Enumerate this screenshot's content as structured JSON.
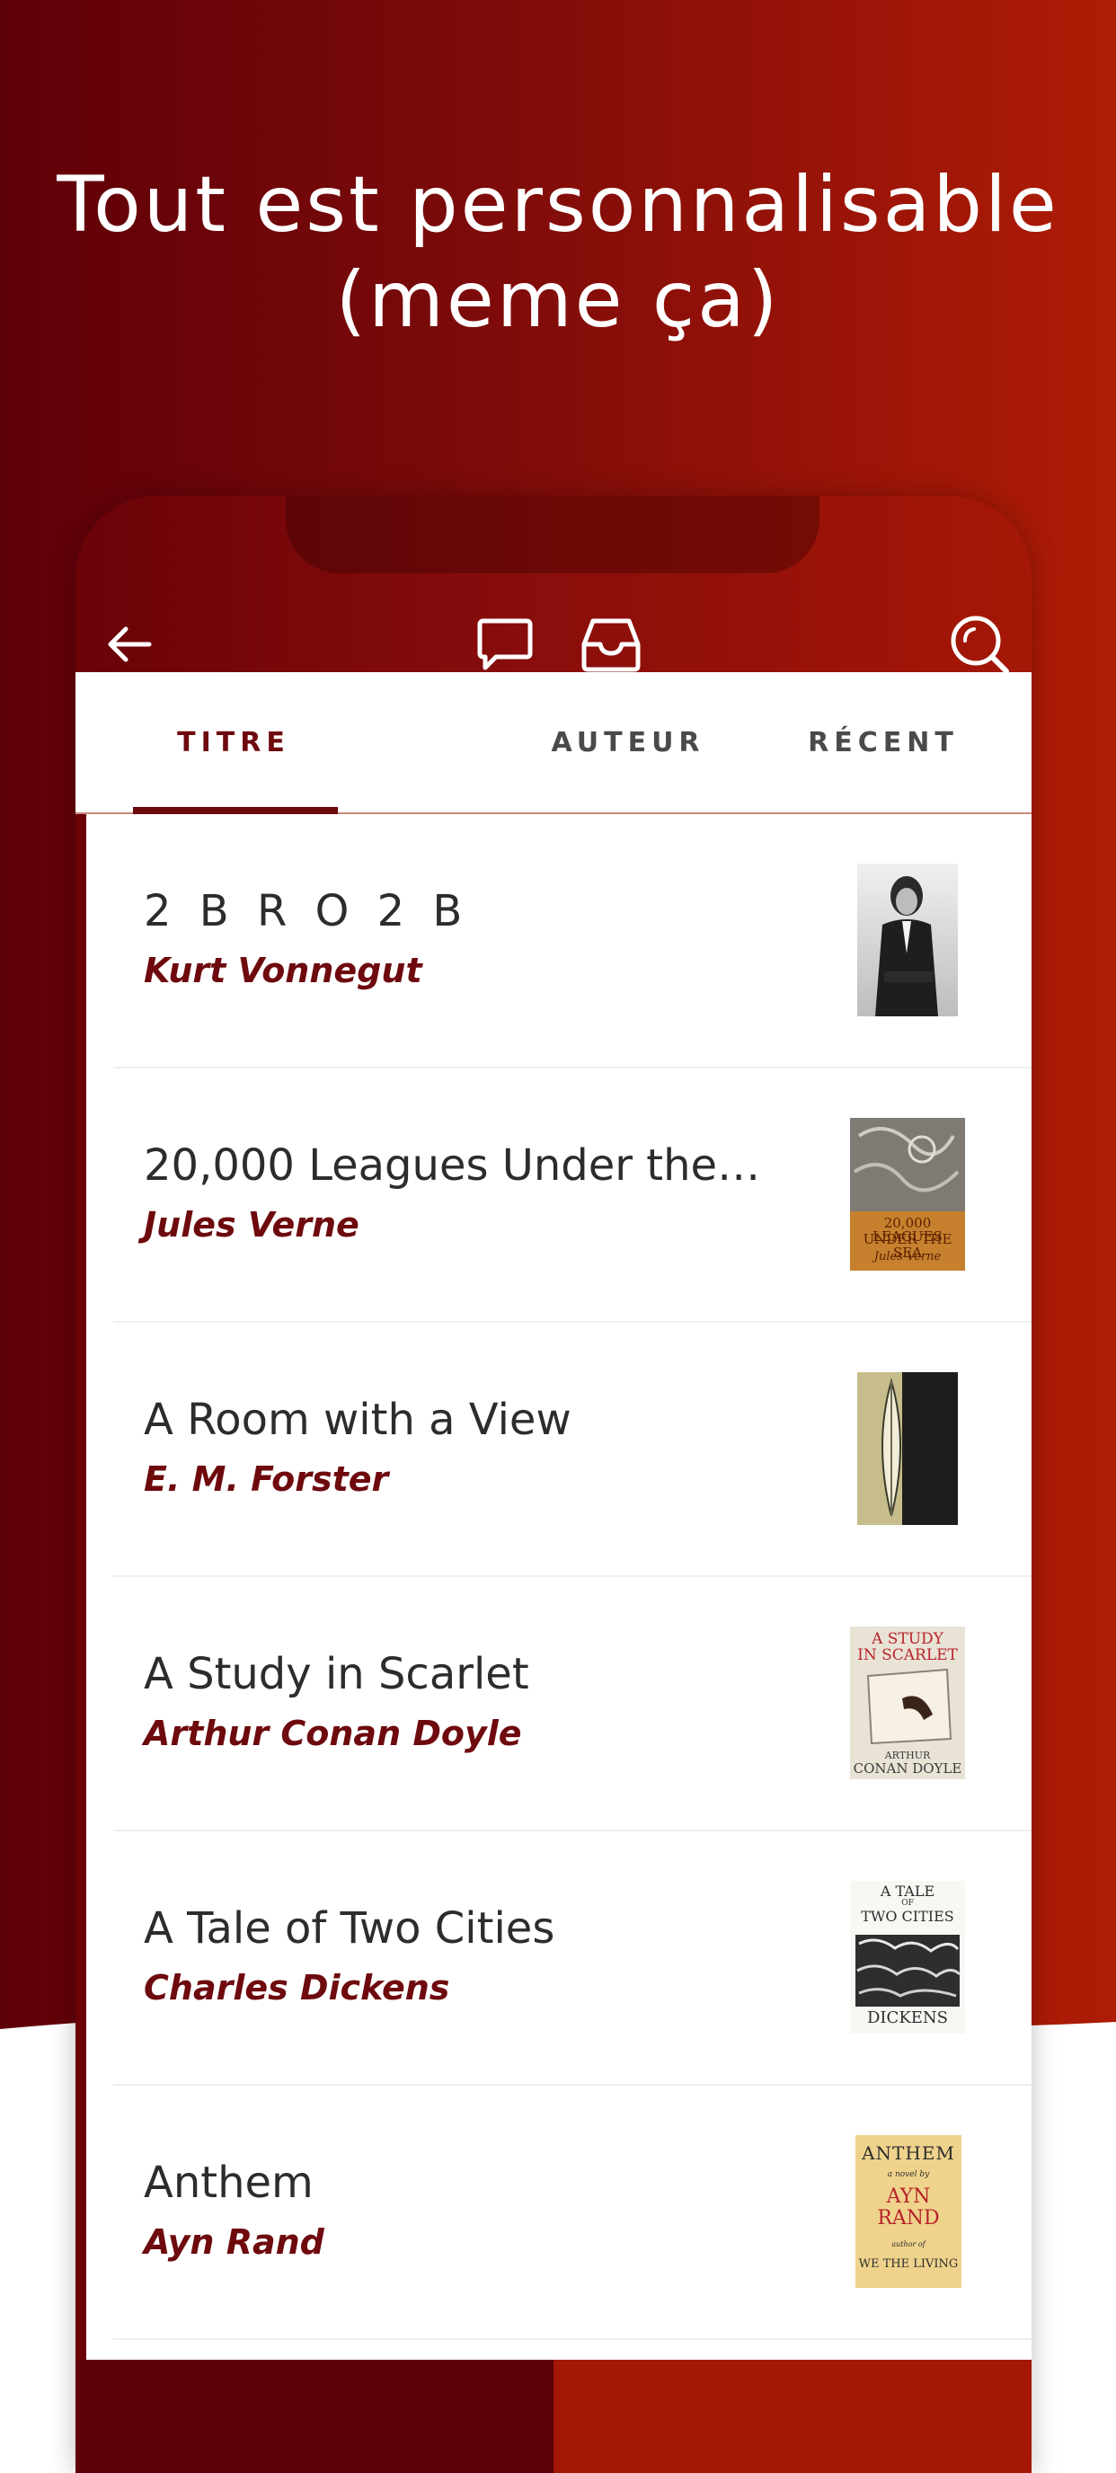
{
  "headline": {
    "line1": "Tout est personnalisable",
    "line2": "(meme ça)"
  },
  "toolbar": {
    "back_icon": "arrow-left-icon",
    "message_icon": "chat-bubble-icon",
    "inbox_icon": "inbox-tray-icon",
    "search_icon": "search-icon"
  },
  "tabs": [
    {
      "label": "TITRE",
      "active": true
    },
    {
      "label": "AUTEUR",
      "active": false
    },
    {
      "label": "RÉCENT",
      "active": false
    }
  ],
  "books": [
    {
      "title": "2 B R O 2 B",
      "author": "Kurt Vonnegut"
    },
    {
      "title": "20,000 Leagues Under the…",
      "author": "Jules Verne"
    },
    {
      "title": "A Room with a View",
      "author": "E. M. Forster"
    },
    {
      "title": "A Study in Scarlet",
      "author": "Arthur Conan Doyle"
    },
    {
      "title": "A Tale of Two Cities",
      "author": "Charles Dickens"
    },
    {
      "title": "Anthem",
      "author": "Ayn Rand"
    }
  ],
  "covers": {
    "leagues": {
      "line1": "20,000 LEAGUES",
      "line2": "UNDER THE SEA",
      "line3": "Jules Verne"
    },
    "scarlet": {
      "line1": "A STUDY",
      "line2": "IN SCARLET",
      "line3": "ARTHUR",
      "line4": "CONAN DOYLE"
    },
    "tale": {
      "line1": "A TALE",
      "line2": "OF",
      "line3": "TWO CITIES",
      "line4": "DICKENS"
    },
    "anthem": {
      "line1": "ANTHEM",
      "line2": "a novel by",
      "line3": "AYN",
      "line4": "RAND",
      "line5": "author of",
      "line6": "WE THE LIVING"
    }
  },
  "colors": {
    "accent": "#6e0a0e",
    "gradient_dark": "#5e0008",
    "gradient_light": "#ae1c05"
  }
}
